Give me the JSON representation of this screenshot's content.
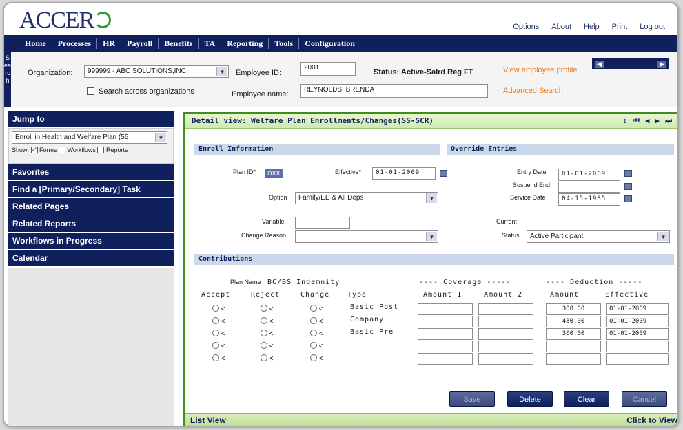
{
  "brand": {
    "logo_text": "ACCER"
  },
  "toplinks": [
    "Options",
    "About",
    "Help",
    "Print",
    "Log out"
  ],
  "nav": [
    "Home",
    "Processes",
    "HR",
    "Payroll",
    "Benefits",
    "TA",
    "Reporting",
    "Tools",
    "Configuration"
  ],
  "search": {
    "tab_label": "Search",
    "org_label": "Organization:",
    "org_value": "999999 - ABC SOLUTIONS,INC.",
    "empid_label": "Employee ID:",
    "empid_value": "2001",
    "status_text": "Status: Active-Salrd Reg FT",
    "view_profile": "View employee profile",
    "across_label": "Search across organizations",
    "empname_label": "Employee name:",
    "empname_value": "REYNOLDS, BRENDA",
    "advanced": "Advanced Search"
  },
  "sidebar": {
    "jump_to": "Jump to",
    "jump_value": "Enroll in Health and Welfare Plan (55",
    "show_label": "Show:",
    "show_forms": "Forms",
    "show_workflows": "Workflows",
    "show_reports": "Reports",
    "items": [
      "Favorites",
      "Find a [Primary/Secondary] Task",
      "Related Pages",
      "Related Reports",
      "Workflows in Progress",
      "Calendar"
    ]
  },
  "panel": {
    "title": "Detail view: Welfare Plan Enrollments/Changes(SS-SCR)",
    "enroll_info": "Enroll Information",
    "override": "Override Entries",
    "plan_id_label": "Plan ID*",
    "plan_id_value": "DXX",
    "effective_label": "Effective*",
    "effective_value": "01-01-2009",
    "option_label": "Option",
    "option_value": "Family/EE & All Deps",
    "variable_label": "Variable",
    "change_reason_label": "Change Reason",
    "entry_date_label": "Entry Date",
    "entry_date_value": "01-01-2009",
    "suspend_end_label": "Suspend End",
    "service_date_label": "Service Date",
    "service_date_value": "04-15-1985",
    "current_label": "Current",
    "status_label": "Status",
    "status_value": "Active Participant",
    "contributions": "Contributions",
    "plan_name_label": "Plan Name",
    "plan_name_value": "BC/BS Indemnity",
    "coverage_head": "---- Coverage -----",
    "deduction_head": "---- Deduction -----",
    "col_accept": "Accept",
    "col_reject": "Reject",
    "col_change": "Change",
    "col_type": "Type",
    "col_amount1": "Amount 1",
    "col_amount2": "Amount 2",
    "col_amount": "Amount",
    "col_effective": "Effective",
    "radio_mark": "<",
    "types": [
      "Basic Post",
      "Company",
      "Basic Pre",
      "",
      ""
    ],
    "deduction_amounts": [
      "300.00",
      "480.00",
      "300.00",
      "",
      ""
    ],
    "deduction_effective": [
      "01-01-2009",
      "01-01-2009",
      "01-01-2009",
      "",
      ""
    ],
    "buttons": {
      "save": "Save",
      "delete": "Delete",
      "clear": "Clear",
      "cancel": "Cancel"
    },
    "list_view": "List View",
    "click_to_view": "Click to View"
  }
}
